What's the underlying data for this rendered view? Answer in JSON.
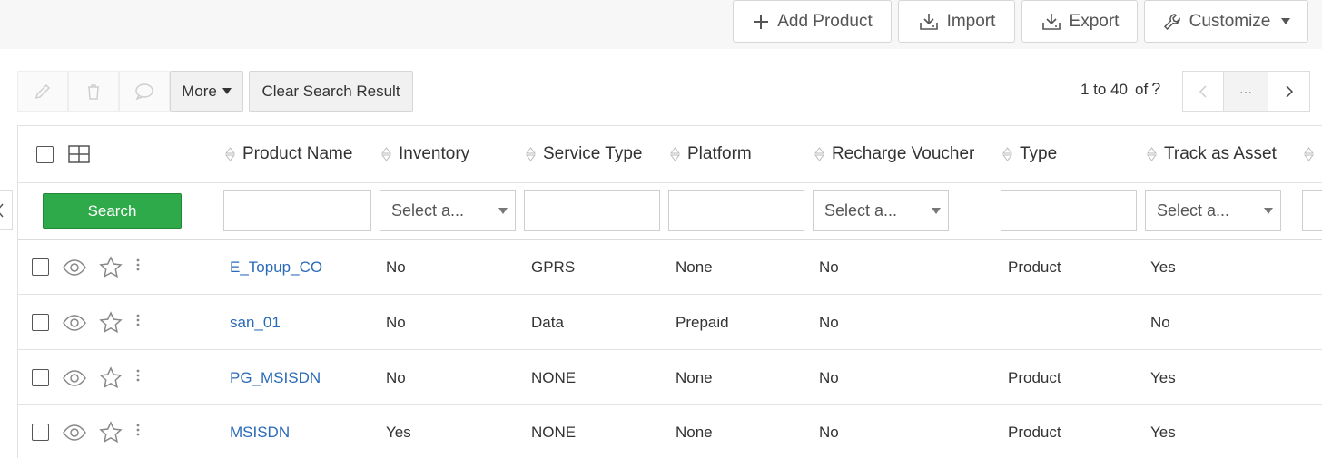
{
  "header": {
    "add_product": "Add Product",
    "import": "Import",
    "export": "Export",
    "customize": "Customize"
  },
  "toolbar": {
    "more": "More",
    "clear_search": "Clear Search Result",
    "page_range": "1 to 40",
    "of_label": "of",
    "of_icon": "?",
    "ellipsis": "···"
  },
  "table": {
    "columns": [
      "Product Name",
      "Inventory",
      "Service Type",
      "Platform",
      "Recharge Voucher",
      "Type",
      "Track as Asset"
    ],
    "search_label": "Search",
    "select_placeholder": "Select a...",
    "rows": [
      {
        "name": "E_Topup_CO",
        "inventory": "No",
        "service_type": "GPRS",
        "platform": "None",
        "recharge_voucher": "No",
        "type": "Product",
        "track_as_asset": "Yes"
      },
      {
        "name": "san_01",
        "inventory": "No",
        "service_type": "Data",
        "platform": "Prepaid",
        "recharge_voucher": "No",
        "type": "",
        "track_as_asset": "No"
      },
      {
        "name": "PG_MSISDN",
        "inventory": "No",
        "service_type": "NONE",
        "platform": "None",
        "recharge_voucher": "No",
        "type": "Product",
        "track_as_asset": "Yes"
      },
      {
        "name": "MSISDN",
        "inventory": "Yes",
        "service_type": "NONE",
        "platform": "None",
        "recharge_voucher": "No",
        "type": "Product",
        "track_as_asset": "Yes"
      }
    ]
  },
  "colors": {
    "link": "#2a6ab8",
    "search_button": "#2eaa4a"
  }
}
